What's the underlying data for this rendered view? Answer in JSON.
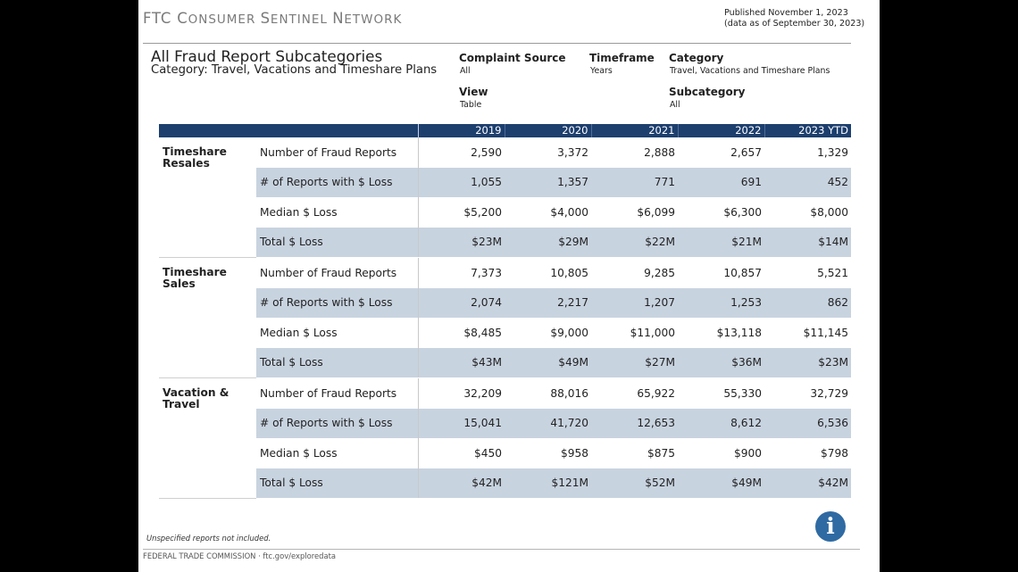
{
  "brand": {
    "part1": "FTC C",
    "part2": "ONSUMER ",
    "part3": "S",
    "part4": "ENTINEL ",
    "part5": "N",
    "part6": "ETWORK"
  },
  "published": {
    "line1": "Published November 1, 2023",
    "line2": "(data as of September 30, 2023)"
  },
  "report": {
    "title": "All Fraud Report Subcategories",
    "subtitle": "Category: Travel, Vacations and Timeshare Plans"
  },
  "filters": {
    "complaint_source": {
      "label": "Complaint Source",
      "value": "All"
    },
    "timeframe": {
      "label": "Timeframe",
      "value": "Years"
    },
    "category": {
      "label": "Category",
      "value": "Travel, Vacations and Timeshare Plans"
    },
    "view": {
      "label": "View",
      "value": "Table"
    },
    "subcategory": {
      "label": "Subcategory",
      "value": "All"
    }
  },
  "table": {
    "years": [
      "2019",
      "2020",
      "2021",
      "2022",
      "2023 YTD"
    ],
    "metrics": [
      "Number of Fraud Reports",
      "# of Reports with $ Loss",
      "Median $ Loss",
      "Total $ Loss"
    ],
    "groups": [
      {
        "name": "Timeshare Resales",
        "rows": [
          [
            "2,590",
            "3,372",
            "2,888",
            "2,657",
            "1,329"
          ],
          [
            "1,055",
            "1,357",
            "771",
            "691",
            "452"
          ],
          [
            "$5,200",
            "$4,000",
            "$6,099",
            "$6,300",
            "$8,000"
          ],
          [
            "$23M",
            "$29M",
            "$22M",
            "$21M",
            "$14M"
          ]
        ]
      },
      {
        "name": "Timeshare Sales",
        "rows": [
          [
            "7,373",
            "10,805",
            "9,285",
            "10,857",
            "5,521"
          ],
          [
            "2,074",
            "2,217",
            "1,207",
            "1,253",
            "862"
          ],
          [
            "$8,485",
            "$9,000",
            "$11,000",
            "$13,118",
            "$11,145"
          ],
          [
            "$43M",
            "$49M",
            "$27M",
            "$36M",
            "$23M"
          ]
        ]
      },
      {
        "name": "Vacation & Travel",
        "rows": [
          [
            "32,209",
            "88,016",
            "65,922",
            "55,330",
            "32,729"
          ],
          [
            "15,041",
            "41,720",
            "12,653",
            "8,612",
            "6,536"
          ],
          [
            "$450",
            "$958",
            "$875",
            "$900",
            "$798"
          ],
          [
            "$42M",
            "$121M",
            "$52M",
            "$49M",
            "$42M"
          ]
        ]
      }
    ]
  },
  "note": "Unspecified reports not included.",
  "footer": "FEDERAL TRADE COMMISSION · ftc.gov/exploredata",
  "info_icon": {
    "glyph": "i",
    "color": "#2f6aa3"
  },
  "colors": {
    "header": "#1d3f6e",
    "row_shade": "#c8d3e0"
  }
}
